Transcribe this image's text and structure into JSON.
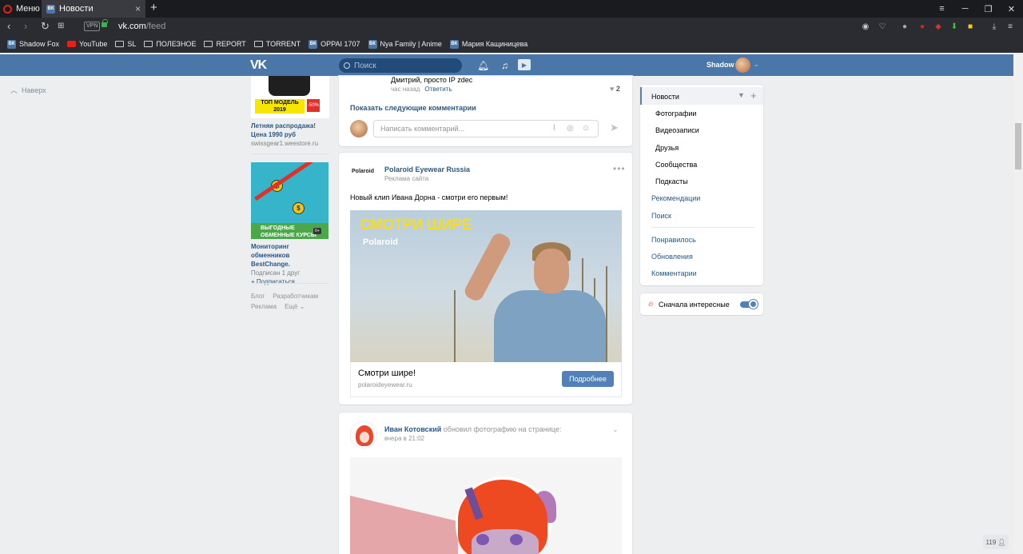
{
  "browser": {
    "menu_label": "Меню",
    "tab_title": "Новости",
    "tab_favicon": "ВК",
    "vpn_label": "VPN",
    "url_host": "vk.com",
    "url_path": "/feed",
    "bookmarks": [
      {
        "label": "Shadow Fox",
        "icon": "vk-icon"
      },
      {
        "label": "YouTube",
        "icon": "youtube-icon"
      },
      {
        "label": "SL",
        "icon": "folder-icon"
      },
      {
        "label": "ПОЛЕЗНОЕ",
        "icon": "folder-icon"
      },
      {
        "label": "REPORT",
        "icon": "folder-icon"
      },
      {
        "label": "TORRENT",
        "icon": "folder-icon"
      },
      {
        "label": "OPPAI 1707",
        "icon": "vk-icon"
      },
      {
        "label": "Nya Family | Anime",
        "icon": "vk-icon"
      },
      {
        "label": "Мария Кащиницева",
        "icon": "vk-icon"
      }
    ]
  },
  "vk_header": {
    "logo": "VK",
    "search_placeholder": "Поиск",
    "user_name": "Shadow"
  },
  "left": {
    "back_to_top": "Наверх",
    "ad1": {
      "banner_text": "ТОП МОДЕЛЬ 2019",
      "sale_badge": "-50%",
      "title": "Летняя распродажа! Цена 1990 руб",
      "domain": "swissgear1.weestore.ru"
    },
    "ad2": {
      "banner_text": "ВЫГОДНЫЕ ОБМЕННЫЕ КУРСЫ",
      "age": "0+",
      "title": "Мониторинг обменников BestChange.",
      "followers": "Подписан 1 друг",
      "subscribe": "+ Подписаться"
    },
    "footer": {
      "blog": "Блог",
      "developers": "Разработчикам",
      "ads": "Реклама",
      "more": "Ещё ⌄"
    }
  },
  "feed": {
    "comment": {
      "author_line": "Дмитрий, просто IP zdec",
      "time": "час назад",
      "reply": "Ответить",
      "likes": "2"
    },
    "show_more_comments": "Показать следующие комментарии",
    "comment_placeholder": "Написать комментарий...",
    "ad_post": {
      "logo": "Polaroid",
      "author": "Polaroid Eyewear Russia",
      "subtitle": "Реклама сайта",
      "text": "Новый клип Ивана Дорна - смотри его первым!",
      "video_title": "СМОТРИ ШИРЕ",
      "video_brand": "Polaroid",
      "link_title": "Смотри шире!",
      "link_domain": "polaroideyewear.ru",
      "button": "Подробнее"
    },
    "photo_post": {
      "author": "Иван Котовский",
      "action": "обновил фотографию на странице:",
      "time": "вчера в 21:02"
    }
  },
  "right_menu": {
    "news": "Новости",
    "photos": "Фотографии",
    "videos": "Видеозаписи",
    "friends": "Друзья",
    "communities": "Сообщества",
    "podcasts": "Подкасты",
    "recommendations": "Рекомендации",
    "search": "Поиск",
    "liked": "Понравилось",
    "updates": "Обновления",
    "comments": "Комментарии",
    "interesting_first": "Сначала интересные",
    "interesting_first_on": true
  },
  "online_counter": "119"
}
